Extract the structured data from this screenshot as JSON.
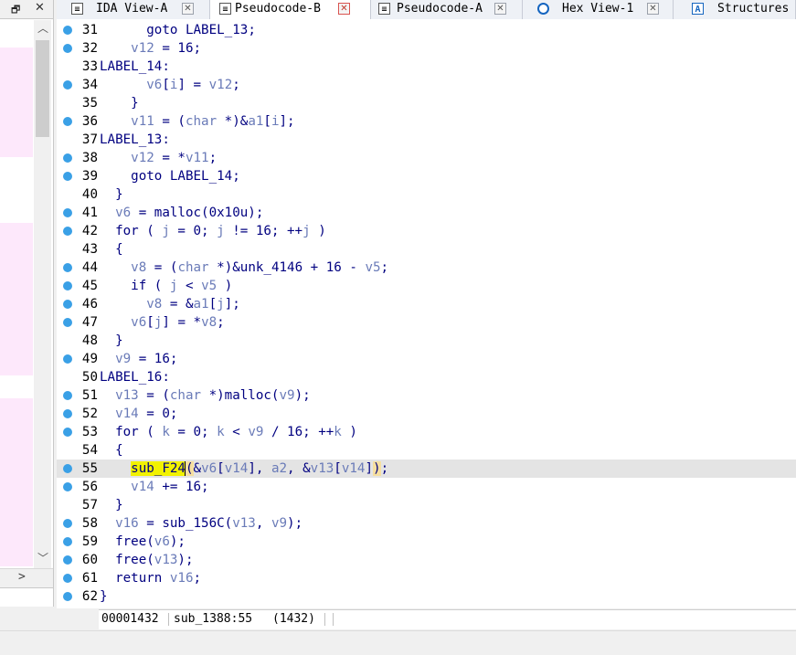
{
  "left_panel": {
    "float_icon": "restore-window-icon",
    "close_glyph": "✕",
    "scroll_up_glyph": "︿",
    "scroll_down_glyph": "﹀",
    "scroll_right_glyph": ">"
  },
  "tabs": [
    {
      "label": "IDA View-A",
      "icon": "disassembly-icon",
      "close": "✕",
      "active": false
    },
    {
      "label": "Pseudocode-B",
      "icon": "pseudocode-icon",
      "close": "✕",
      "active": true
    },
    {
      "label": "Pseudocode-A",
      "icon": "pseudocode-icon",
      "close": "✕",
      "active": false
    },
    {
      "label": "Hex View-1",
      "icon": "hex-icon",
      "close": "✕",
      "active": false
    },
    {
      "label": "Structures",
      "icon": "structures-icon",
      "close": "",
      "active": false
    }
  ],
  "code": {
    "breakpoint_color": "#3aa0e6",
    "lines": [
      {
        "num": "31",
        "bp": true,
        "html": "      <span class=\"kw\">goto</span> <span class=\"n\">LABEL_13</span>;"
      },
      {
        "num": "32",
        "bp": true,
        "html": "    <span class=\"v\">v12</span> = <span class=\"n\">16</span>;"
      },
      {
        "num": "33",
        "bp": false,
        "label": true,
        "html": "LABEL_14:"
      },
      {
        "num": "34",
        "bp": true,
        "html": "      <span class=\"v\">v6</span>[<span class=\"v\">i</span>] = <span class=\"v\">v12</span>;"
      },
      {
        "num": "35",
        "bp": false,
        "html": "    }"
      },
      {
        "num": "36",
        "bp": true,
        "html": "    <span class=\"v\">v11</span> = (<span class=\"grey\">char</span> *)&amp;<span class=\"v\">a1</span>[<span class=\"v\">i</span>];"
      },
      {
        "num": "37",
        "bp": false,
        "label": true,
        "html": "LABEL_13:"
      },
      {
        "num": "38",
        "bp": true,
        "html": "    <span class=\"v\">v12</span> = *<span class=\"v\">v11</span>;"
      },
      {
        "num": "39",
        "bp": true,
        "html": "    <span class=\"kw\">goto</span> LABEL_14;"
      },
      {
        "num": "40",
        "bp": false,
        "html": "  }"
      },
      {
        "num": "41",
        "bp": true,
        "html": "  <span class=\"v\">v6</span> = malloc(0x10u);"
      },
      {
        "num": "42",
        "bp": true,
        "html": "  <span class=\"kw\">for</span> ( <span class=\"v\">j</span> = 0; <span class=\"v\">j</span> != 16; ++<span class=\"v\">j</span> )"
      },
      {
        "num": "43",
        "bp": false,
        "html": "  {"
      },
      {
        "num": "44",
        "bp": true,
        "html": "    <span class=\"v\">v8</span> = (<span class=\"grey\">char</span> *)&amp;unk_4146 + 16 - <span class=\"v\">v5</span>;"
      },
      {
        "num": "45",
        "bp": true,
        "html": "    <span class=\"kw\">if</span> ( <span class=\"v\">j</span> &lt; <span class=\"v\">v5</span> )"
      },
      {
        "num": "46",
        "bp": true,
        "html": "      <span class=\"v\">v8</span> = &amp;<span class=\"v\">a1</span>[<span class=\"v\">j</span>];"
      },
      {
        "num": "47",
        "bp": true,
        "html": "    <span class=\"v\">v6</span>[<span class=\"v\">j</span>] = *<span class=\"v\">v8</span>;"
      },
      {
        "num": "48",
        "bp": false,
        "html": "  }"
      },
      {
        "num": "49",
        "bp": true,
        "html": "  <span class=\"v\">v9</span> = 16;"
      },
      {
        "num": "50",
        "bp": false,
        "label": true,
        "html": "LABEL_16:"
      },
      {
        "num": "51",
        "bp": true,
        "html": "  <span class=\"v\">v13</span> = (<span class=\"grey\">char</span> *)malloc(<span class=\"v\">v9</span>);"
      },
      {
        "num": "52",
        "bp": true,
        "html": "  <span class=\"v\">v14</span> = 0;"
      },
      {
        "num": "53",
        "bp": true,
        "html": "  <span class=\"kw\">for</span> ( <span class=\"v\">k</span> = 0; <span class=\"v\">k</span> &lt; <span class=\"v\">v9</span> / 16; ++<span class=\"v\">k</span> )"
      },
      {
        "num": "54",
        "bp": false,
        "html": "  {"
      },
      {
        "num": "55",
        "bp": true,
        "highlight": true,
        "html": "    <span class=\"hl-yellow\">sub_F24</span><span class=\"hl-paren caret\">(</span>&amp;<span class=\"v\">v6</span>[<span class=\"v\">v14</span>], <span class=\"v\">a2</span>, &amp;<span class=\"v\">v13</span>[<span class=\"v\">v14</span>]<span class=\"hl-paren\">)</span>;"
      },
      {
        "num": "56",
        "bp": true,
        "html": "    <span class=\"v\">v14</span> += 16;"
      },
      {
        "num": "57",
        "bp": false,
        "html": "  }"
      },
      {
        "num": "58",
        "bp": true,
        "html": "  <span class=\"v\">v16</span> = sub_156C(<span class=\"v\">v13</span>, <span class=\"v\">v9</span>);"
      },
      {
        "num": "59",
        "bp": true,
        "html": "  free(<span class=\"v\">v6</span>);"
      },
      {
        "num": "60",
        "bp": true,
        "html": "  free(<span class=\"v\">v13</span>);"
      },
      {
        "num": "61",
        "bp": true,
        "html": "  <span class=\"kw\">return</span> <span class=\"v\">v16</span>;"
      },
      {
        "num": "62",
        "bp": true,
        "html": "}"
      }
    ]
  },
  "status": {
    "address": "00001432",
    "location": "sub_1388:55",
    "offset": "(1432)"
  }
}
